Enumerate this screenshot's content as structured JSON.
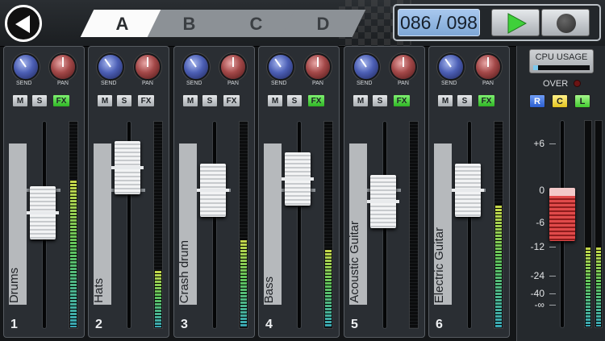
{
  "tabs": [
    {
      "label": "A",
      "active": true
    },
    {
      "label": "B",
      "active": false
    },
    {
      "label": "C",
      "active": false
    },
    {
      "label": "D",
      "active": false
    }
  ],
  "transport": {
    "counter": "086 / 098"
  },
  "knob_labels": {
    "send": "SEND",
    "pan": "PAN"
  },
  "button_labels": {
    "mute": "M",
    "solo": "S",
    "fx": "FX"
  },
  "channels": [
    {
      "number": "1",
      "name": "Drums",
      "fx_on": true,
      "fader_db": -2,
      "meter_level": 0.72
    },
    {
      "number": "2",
      "name": "Hats",
      "fx_on": false,
      "fader_db": 2,
      "meter_level": 0.28
    },
    {
      "number": "3",
      "name": "Crash drum",
      "fx_on": false,
      "fader_db": 0,
      "meter_level": 0.43
    },
    {
      "number": "4",
      "name": "Bass",
      "fx_on": true,
      "fader_db": 1,
      "meter_level": 0.38
    },
    {
      "number": "5",
      "name": "Acoustic Guitar",
      "fx_on": true,
      "fader_db": -1,
      "meter_level": 0.0
    },
    {
      "number": "6",
      "name": "Electric Guitar",
      "fx_on": true,
      "fader_db": 0,
      "meter_level": 0.6
    }
  ],
  "master": {
    "cpu_label": "CPU USAGE",
    "cpu_level": 0.08,
    "over_label": "OVER",
    "buttons": [
      "R",
      "C",
      "L"
    ],
    "scale": [
      "+6",
      "0",
      "-6",
      "-12",
      "-24",
      "-40",
      "-∞"
    ],
    "meter_level": 0.39
  },
  "colors": {
    "fx_on": "#2fb625",
    "send_knob": "#4c5fb5",
    "pan_knob": "#a34848",
    "master_fader": "#e04a4a"
  }
}
